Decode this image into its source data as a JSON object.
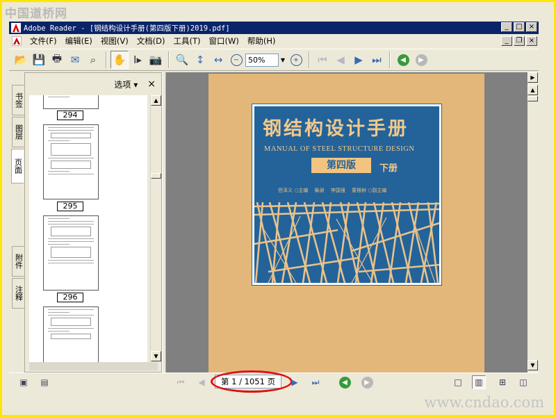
{
  "watermarks": {
    "top": "中国道桥网",
    "bottom": "www.cndao.com"
  },
  "window": {
    "title": "Adobe Reader - [钢结构设计手册(第四版下册)2019.pdf]"
  },
  "window_buttons": {
    "minimize": "_",
    "maximize": "□",
    "close": "×"
  },
  "menu": {
    "items": [
      "文件(F)",
      "编辑(E)",
      "视图(V)",
      "文档(D)",
      "工具(T)",
      "窗口(W)",
      "帮助(H)"
    ]
  },
  "toolbar": {
    "zoom_value": "50%",
    "icons": [
      "open-folder-icon",
      "save-icon",
      "print-icon",
      "email-icon",
      "search-binoculars-icon",
      "hand-tool-icon",
      "select-text-icon",
      "snapshot-icon",
      "zoom-in-tool-icon",
      "fit-page-icon",
      "fit-width-icon",
      "zoom-out-icon",
      "zoom-in-icon",
      "first-page-icon",
      "prev-page-icon",
      "next-page-icon",
      "last-page-icon",
      "back-icon",
      "forward-icon"
    ]
  },
  "nav_tabs": [
    {
      "label": "书签",
      "selected": false
    },
    {
      "label": "图层",
      "selected": false
    },
    {
      "label": "页面",
      "selected": true
    },
    {
      "label": "附件",
      "selected": false
    },
    {
      "label": "注释",
      "selected": false
    }
  ],
  "panel": {
    "options_label": "选项 ▾",
    "close_label": "×"
  },
  "thumbnails": [
    {
      "page": "294"
    },
    {
      "page": "295"
    },
    {
      "page": "296"
    }
  ],
  "cover": {
    "title": "钢结构设计手册",
    "subtitle_en": "MANUAL OF STEEL STRUCTURE DESIGN",
    "edition": "第四版",
    "volume": "下册",
    "authors": "但泽义 ○主编 　柴昶　 李国强 　童根树 ○副主编"
  },
  "status": {
    "page_display": "第 1 / 1051 页",
    "highlight_color": "#e01010"
  },
  "colors": {
    "title_bar": "#0a246a",
    "cover_blue": "#23639a",
    "cover_paper": "#e3b77a"
  }
}
